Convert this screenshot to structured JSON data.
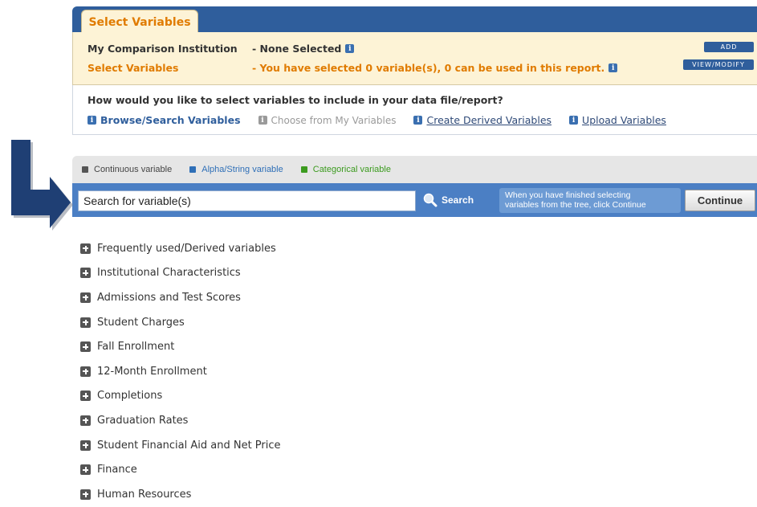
{
  "tab": {
    "label": "Select Variables"
  },
  "comparison": {
    "label": "My Comparison Institution",
    "value": "- None Selected",
    "add_label": "ADD"
  },
  "selection": {
    "label": "Select Variables",
    "value": "- You have selected 0 variable(s), 0 can be used in this report.",
    "view_modify_label": "VIEW/MODIFY"
  },
  "question": "How would you like to select variables to include in your data file/report?",
  "methods": [
    {
      "label": "Browse/Search Variables"
    },
    {
      "label": "Choose from My Variables"
    },
    {
      "label": "Create Derived Variables"
    },
    {
      "label": "Upload Variables"
    }
  ],
  "legend": [
    {
      "label": "Continuous variable",
      "color": "#555555"
    },
    {
      "label": "Alpha/String variable",
      "color": "#2f6fb7"
    },
    {
      "label": "Categorical variable",
      "color": "#3c9b1f"
    }
  ],
  "search": {
    "placeholder": "Search for variable(s)",
    "button_label": "Search",
    "hint_line1": "When you have finished selecting",
    "hint_line2": "variables from the tree, click Continue",
    "continue_label": "Continue"
  },
  "icons": {
    "info": "info-icon",
    "expand": "plus-icon",
    "search": "magnifier-icon",
    "pointer": "arrow-icon"
  },
  "tree": [
    "Frequently used/Derived variables",
    "Institutional Characteristics",
    "Admissions and Test Scores",
    "Student Charges",
    "Fall Enrollment",
    "12-Month Enrollment",
    "Completions",
    "Graduation Rates",
    "Student Financial Aid and Net Price",
    "Finance",
    "Human Resources"
  ],
  "colors": {
    "brand_blue": "#2f5e9c",
    "accent_orange": "#e07b00",
    "panel_yellow": "#fdf3d6"
  }
}
